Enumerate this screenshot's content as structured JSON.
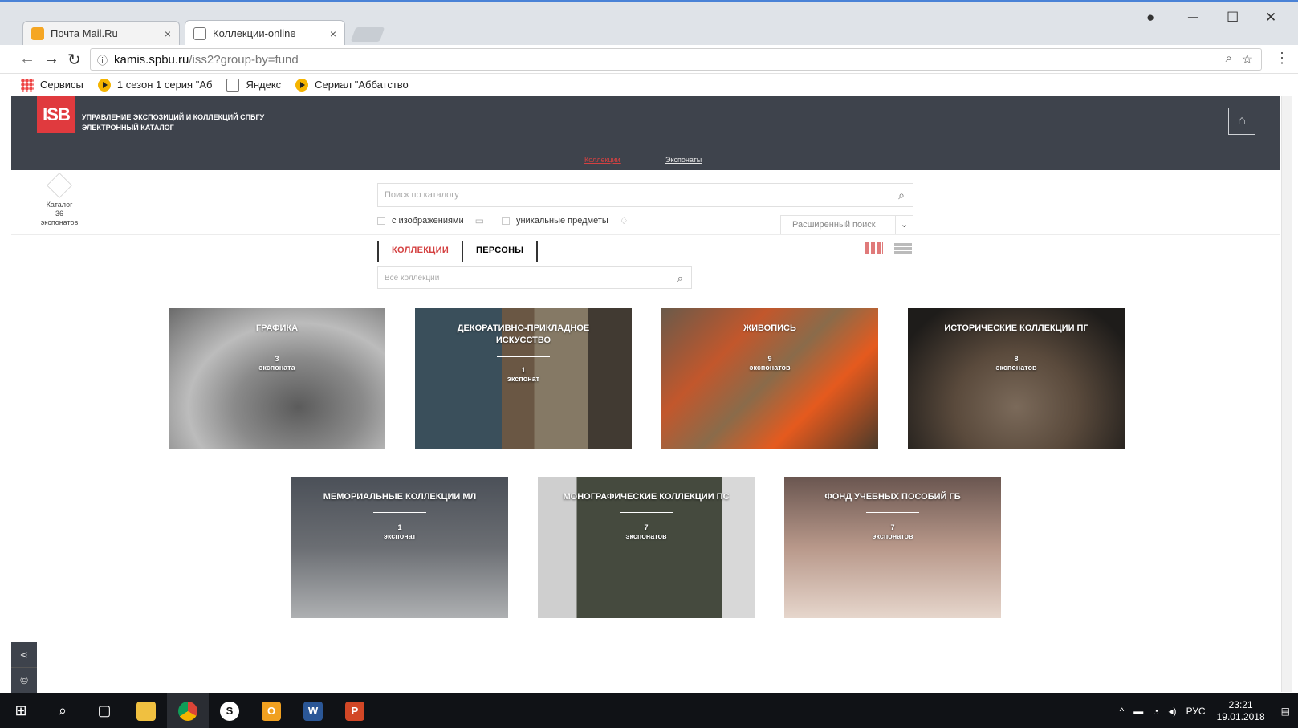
{
  "browser": {
    "tabs": [
      {
        "label": "Почта Mail.Ru",
        "close": "×"
      },
      {
        "label": "Коллекции-online",
        "close": "×"
      }
    ],
    "url_host": "kamis.spbu.ru",
    "url_path": "/iss2?group-by=fund",
    "bookmarks": [
      "Сервисы",
      "1 сезон 1 серия \"Аб",
      "Яндекс",
      "Сериал \"Аббатство"
    ]
  },
  "site": {
    "logo_text": "ISB",
    "title_line1": "Управление экспозиций и коллекций СПбГУ",
    "title_line2": "Электронный каталог",
    "nav": [
      "Коллекции",
      "Экспонаты"
    ],
    "catalog_label": "Каталог",
    "catalog_count": "36",
    "catalog_unit": "экспонатов"
  },
  "search": {
    "placeholder": "Поиск по каталогу",
    "filter_images": "с изображениями",
    "filter_unique": "уникальные предметы",
    "advanced": "Расширенный поиск"
  },
  "tabs": [
    "КОЛЛЕКЦИИ",
    "ПЕРСОНЫ"
  ],
  "collections_search_placeholder": "Все коллекции",
  "collections": [
    {
      "title": "Графика",
      "count": "3",
      "unit": "экспоната"
    },
    {
      "title": "Декоративно-прикладное искусство",
      "count": "1",
      "unit": "экспонат"
    },
    {
      "title": "Живопись",
      "count": "9",
      "unit": "экспонатов"
    },
    {
      "title": "Исторические коллекции ПГ",
      "count": "8",
      "unit": "экспонатов"
    },
    {
      "title": "Мемориальные коллекции МЛ",
      "count": "1",
      "unit": "экспонат"
    },
    {
      "title": "Монографические коллекции ПС",
      "count": "7",
      "unit": "экспонатов"
    },
    {
      "title": "Фонд учебных пособий ГБ",
      "count": "7",
      "unit": "экспонатов"
    }
  ],
  "taskbar": {
    "lang": "РУС",
    "time": "23:21",
    "date": "19.01.2018"
  },
  "colors": {
    "accent": "#d44141",
    "header": "#3e434c"
  }
}
